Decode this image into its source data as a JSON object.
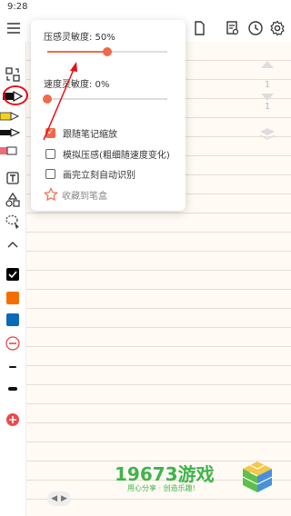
{
  "status_bar": {
    "time": "9:28"
  },
  "toolbar": {
    "menu_icon": "menu-icon",
    "icons": [
      "document-icon",
      "note-search-icon",
      "history-clock-icon",
      "settings-gear-icon"
    ]
  },
  "pen_settings_popup": {
    "pressure_label": "压感灵敏度: 50%",
    "pressure_value": 50,
    "speed_label": "速度灵敏度: 0%",
    "speed_value": 0,
    "checkboxes": [
      {
        "label": "跟随笔记缩放",
        "checked": true
      },
      {
        "label": "模拟压感(粗细随速度变化)",
        "checked": false
      },
      {
        "label": "画完立刻自动识别",
        "checked": false
      }
    ],
    "favorite_label": "收藏到笔盒"
  },
  "page_indicator": {
    "current": "1",
    "total": "1"
  },
  "watermark": {
    "title": "19673游戏",
    "slogan": "用心分享 · 创造乐趣!"
  },
  "bottom_nav": {
    "left": "◀",
    "right": "▶"
  },
  "colors": {
    "accent": "#f06a4a",
    "annotation_red": "#e8101a",
    "paper": "#fffaf4",
    "paper_lines": "#eadbd0",
    "swatch_black": "#000000",
    "swatch_orange": "#f46f00",
    "swatch_blue": "#0a6ab8",
    "watermark_green": "#3fb44a"
  }
}
